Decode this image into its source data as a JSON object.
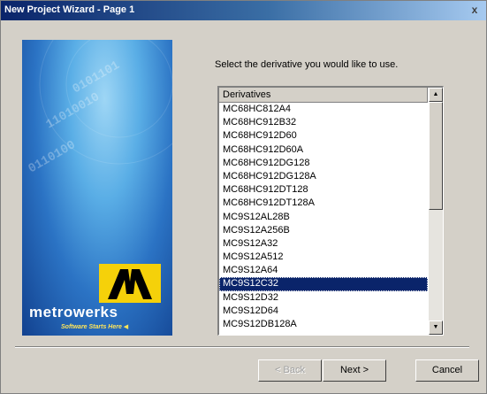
{
  "window": {
    "title": "New Project Wizard - Page 1",
    "close_glyph": "x"
  },
  "banner": {
    "brand": "metrowerks",
    "tagline": "Software Starts Here"
  },
  "prompt": "Select the derivative you would like to use.",
  "list": {
    "header": "Derivatives",
    "items": [
      "MC68HC812A4",
      "MC68HC912B32",
      "MC68HC912D60",
      "MC68HC912D60A",
      "MC68HC912DG128",
      "MC68HC912DG128A",
      "MC68HC912DT128",
      "MC68HC912DT128A",
      "MC9S12AL28B",
      "MC9S12A256B",
      "MC9S12A32",
      "MC9S12A512",
      "MC9S12A64",
      "MC9S12C32",
      "MC9S12D32",
      "MC9S12D64",
      "MC9S12DB128A"
    ],
    "selected_index": 13
  },
  "buttons": {
    "back": "< Back",
    "next": "Next >",
    "cancel": "Cancel"
  },
  "colors": {
    "title_bar": "#0a246a",
    "selection": "#0a246a",
    "logo_yellow": "#f5d10a",
    "dialog_face": "#d4d0c8"
  }
}
